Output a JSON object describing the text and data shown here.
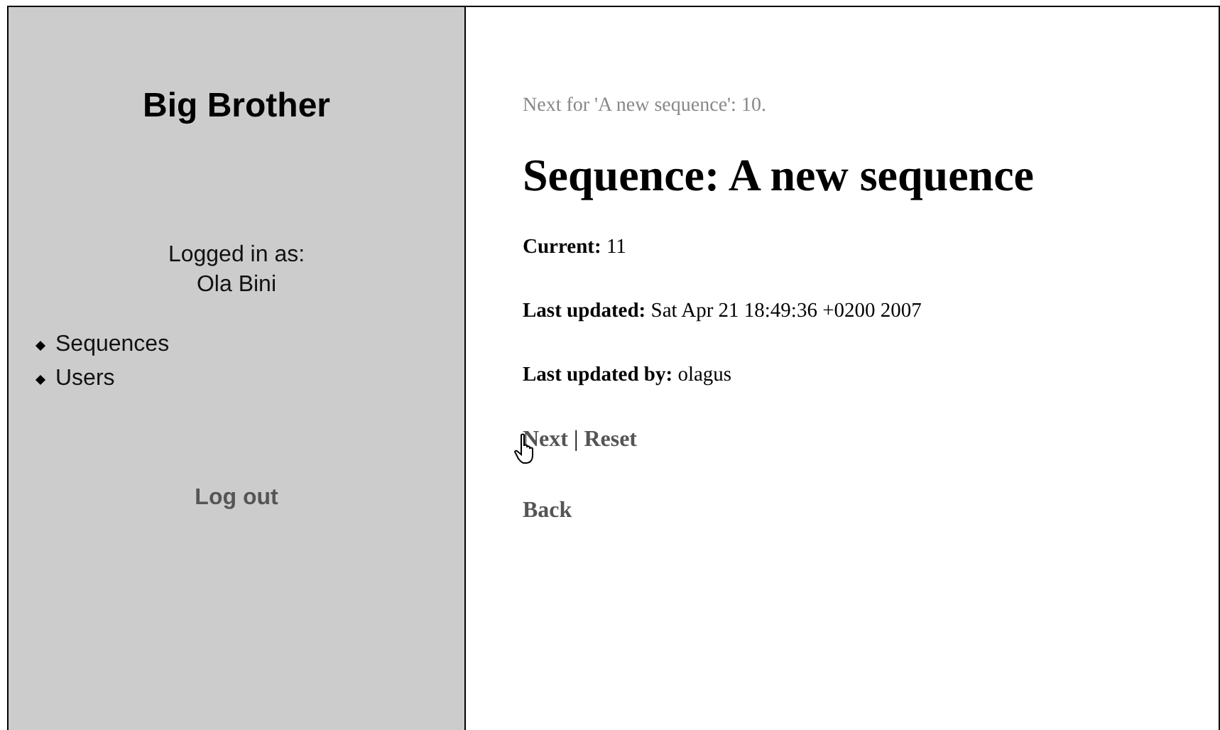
{
  "sidebar": {
    "title": "Big Brother",
    "logged_in_label": "Logged in as:",
    "user_name": "Ola Bini",
    "nav_items": [
      "Sequences",
      "Users"
    ],
    "logout": "Log out"
  },
  "main": {
    "notice": "Next for 'A new sequence': 10.",
    "heading": "Sequence: A new sequence",
    "fields": [
      "**Current:** 11",
      "**Last updated:** Sat Apr 21 18:49:36 +0200 2007",
      "**Last updated by:** olagus"
    ],
    "actions": [
      "Next",
      "Reset"
    ],
    "separator": "|",
    "back": "Back"
  }
}
